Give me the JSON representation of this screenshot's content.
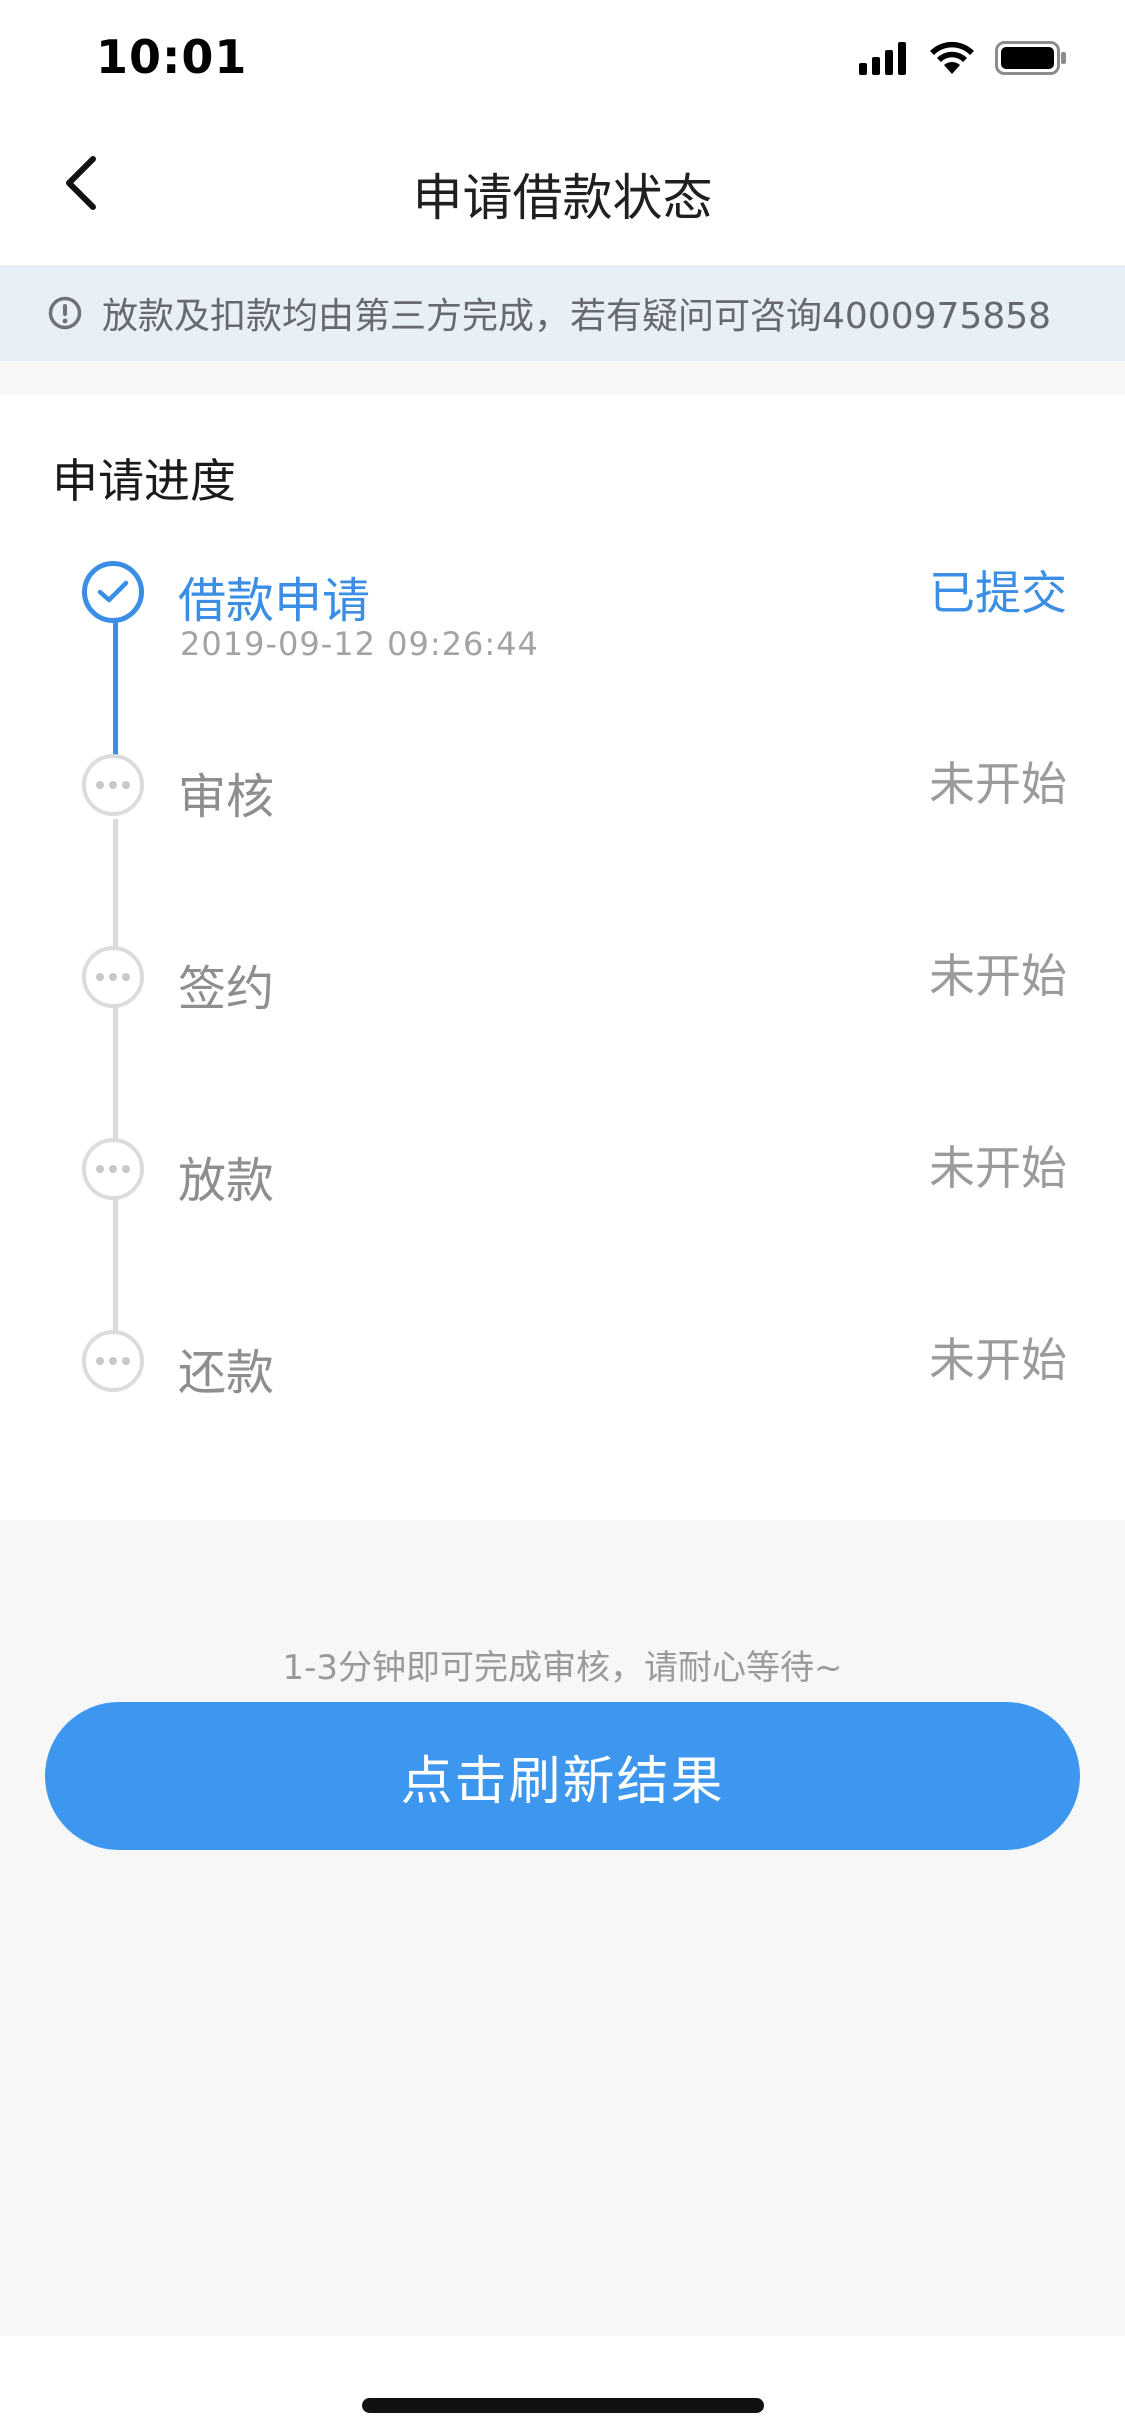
{
  "status_bar": {
    "time": "10:01",
    "icons": [
      "signal-icon",
      "wifi-icon",
      "battery-icon"
    ]
  },
  "nav": {
    "title": "申请借款状态",
    "back_icon": "chevron-left-icon"
  },
  "notice": {
    "icon": "info-circle-icon",
    "text": "放款及扣款均由第三方完成，若有疑问可咨询4000975858"
  },
  "progress": {
    "section_title": "申请进度",
    "steps": [
      {
        "label": "借款申请",
        "time": "2019-09-12 09:26:44",
        "status": "已提交",
        "state": "done"
      },
      {
        "label": "审核",
        "status": "未开始",
        "state": "pending"
      },
      {
        "label": "签约",
        "status": "未开始",
        "state": "pending"
      },
      {
        "label": "放款",
        "status": "未开始",
        "state": "pending"
      },
      {
        "label": "还款",
        "status": "未开始",
        "state": "pending"
      }
    ]
  },
  "footer": {
    "hint": "1-3分钟即可完成审核，请耐心等待~",
    "refresh_button": "点击刷新结果"
  },
  "colors": {
    "accent": "#3a8ee6",
    "button": "#3d97ef",
    "notice_bg": "#e8eff7",
    "page_bg": "#f7f7f8"
  }
}
